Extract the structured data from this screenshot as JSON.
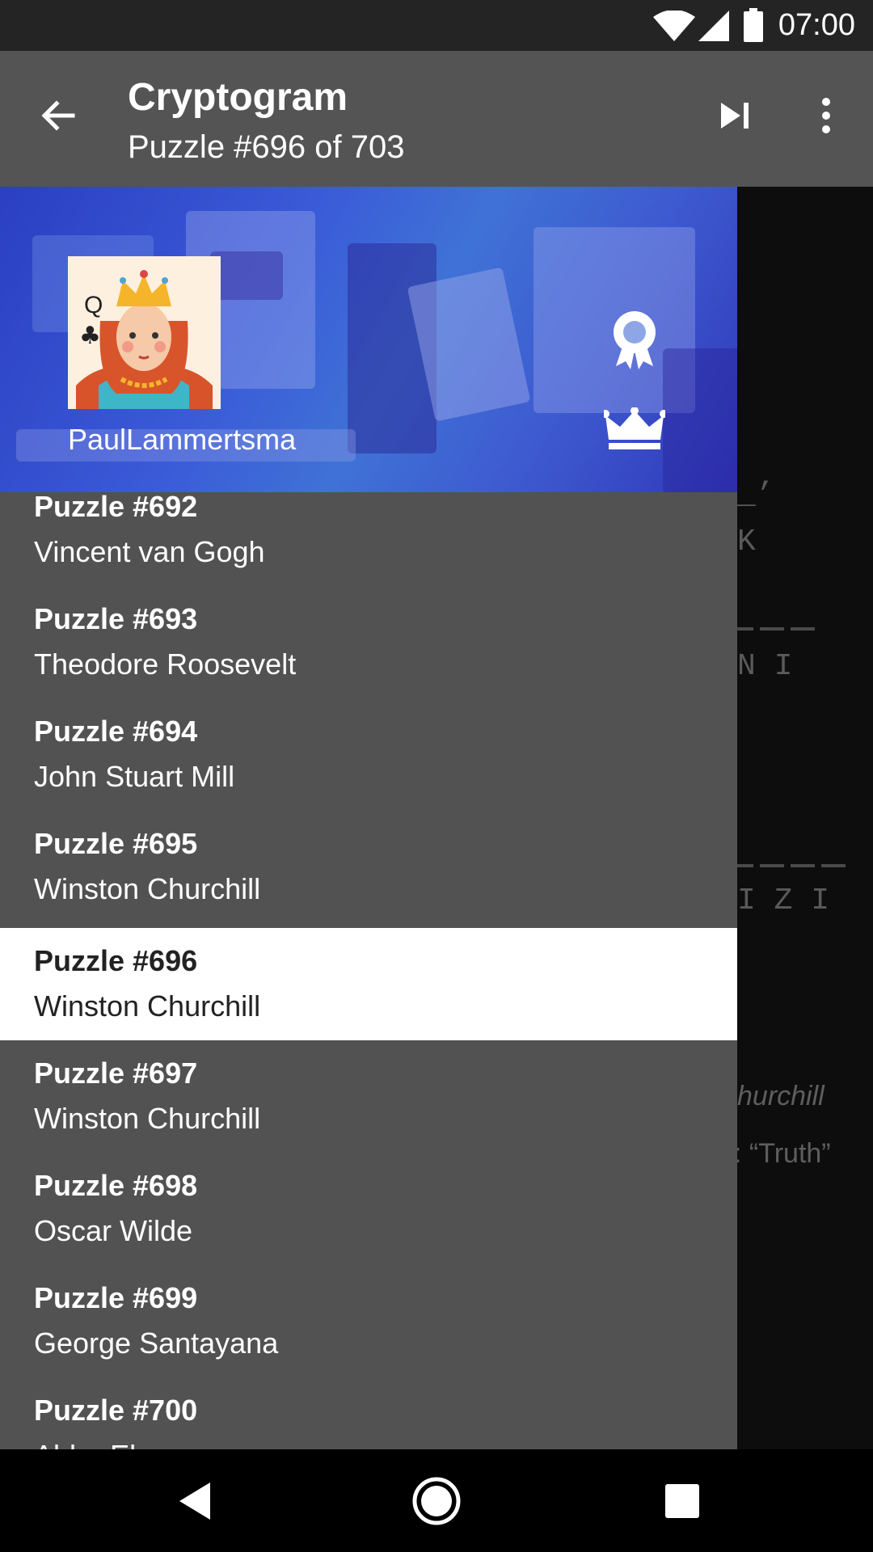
{
  "status_bar": {
    "time": "07:00"
  },
  "app_bar": {
    "title": "Cryptogram",
    "subtitle": "Puzzle #696 of 703",
    "icons": [
      "back-arrow-icon",
      "skip-next-icon",
      "more-vert-icon"
    ]
  },
  "drawer": {
    "username": "PaulLammertsma",
    "avatar_card": {
      "rank": "Q",
      "suit": "♣"
    },
    "header_icons": [
      "achievements-icon",
      "leaderboard-crown-icon"
    ],
    "items": [
      {
        "title": "Puzzle #692",
        "subtitle": "Vincent van Gogh",
        "active": false
      },
      {
        "title": "Puzzle #693",
        "subtitle": "Theodore Roosevelt",
        "active": false
      },
      {
        "title": "Puzzle #694",
        "subtitle": "John Stuart Mill",
        "active": false
      },
      {
        "title": "Puzzle #695",
        "subtitle": "Winston Churchill",
        "active": false
      },
      {
        "title": "Puzzle #696",
        "subtitle": "Winston Churchill",
        "active": true
      },
      {
        "title": "Puzzle #697",
        "subtitle": "Winston Churchill",
        "active": false
      },
      {
        "title": "Puzzle #698",
        "subtitle": "Oscar Wilde",
        "active": false
      },
      {
        "title": "Puzzle #699",
        "subtitle": "George Santayana",
        "active": false
      },
      {
        "title": "Puzzle #700",
        "subtitle": "Abba Eban",
        "active": false
      }
    ]
  },
  "background_content": {
    "fragments": [
      "_’",
      "K",
      "N I",
      "I Z I",
      "hurchill",
      ": “Truth”"
    ]
  },
  "colors": {
    "app_bar": "#545454",
    "drawer": "#525252",
    "active_item": "#ffffff",
    "header_blue": "#3a5ad8"
  }
}
